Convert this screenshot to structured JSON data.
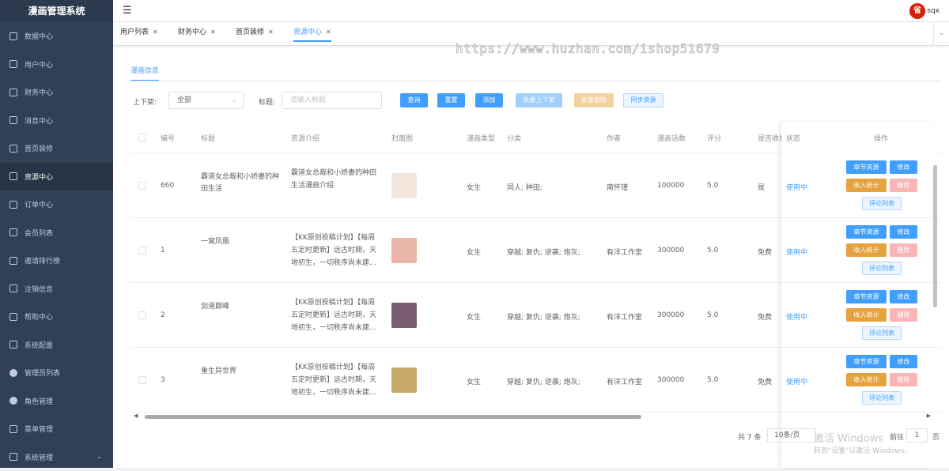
{
  "app": {
    "title": "漫画管理系统",
    "username": "sqx",
    "avatar_text": "省"
  },
  "sidebar": {
    "items": [
      {
        "label": "数据中心",
        "icon": "monitor-icon"
      },
      {
        "label": "用户中心",
        "icon": "user-icon"
      },
      {
        "label": "财务中心",
        "icon": "wallet-icon"
      },
      {
        "label": "消息中心",
        "icon": "message-icon"
      },
      {
        "label": "首页装修",
        "icon": "cube-icon"
      },
      {
        "label": "资源中心",
        "icon": "document-icon"
      },
      {
        "label": "订单中心",
        "icon": "order-icon"
      },
      {
        "label": "会员列表",
        "icon": "grid-icon"
      },
      {
        "label": "邀请排行榜",
        "icon": "bar-chart-icon"
      },
      {
        "label": "注销信息",
        "icon": "inbox-icon"
      },
      {
        "label": "帮助中心",
        "icon": "help-doc-icon"
      },
      {
        "label": "系统配置",
        "icon": "list-icon"
      },
      {
        "label": "管理员列表",
        "icon": "person-icon"
      },
      {
        "label": "角色管理",
        "icon": "role-icon"
      },
      {
        "label": "菜单管理",
        "icon": "menu-list-icon"
      },
      {
        "label": "系统管理",
        "icon": "settings-icon"
      }
    ]
  },
  "tags": [
    {
      "label": "用户列表"
    },
    {
      "label": "财务中心"
    },
    {
      "label": "首页装修"
    },
    {
      "label": "资源中心"
    }
  ],
  "subtab": "漫画信息",
  "filters": {
    "status_label": "上下架:",
    "status_value": "全部",
    "title_label": "标题:",
    "title_placeholder": "请输入标题"
  },
  "buttons": {
    "query": "查询",
    "reset": "重置",
    "add": "添加",
    "batch_shelf": "批量上下架",
    "batch_delete": "批量删除",
    "sync": "同步资源"
  },
  "table": {
    "columns": [
      "编号",
      "标题",
      "资源介绍",
      "封面图",
      "漫画类型",
      "分类",
      "作者",
      "漫画话数",
      "评分",
      "是否收费",
      "状态",
      "操作"
    ],
    "rows": [
      {
        "id": "660",
        "title": "霸道女总裁和小娇妻的种田生活",
        "intro": "霸道女总裁和小娇妻的种田生活漫画介绍",
        "cover_color": "#f2e6dc",
        "type": "女生",
        "category": "同人; 种田;",
        "author": "南怀瑾",
        "episodes": "100000",
        "score": "5.0",
        "paid": "是",
        "status": "使用中"
      },
      {
        "id": "1",
        "title": "一窝凤凰",
        "intro": "【KK原创投稿计划】【每周五定时更新】远古时期，天地初生，一切秩序尚未建…",
        "cover_color": "#e8b5a8",
        "type": "女生",
        "category": "穿越; 复仇; 逆袭; 炮灰;",
        "author": "有洋工作室",
        "episodes": "300000",
        "score": "5.0",
        "paid": "免费",
        "status": "使用中"
      },
      {
        "id": "2",
        "title": "剑道巅峰",
        "intro": "【KK原创投稿计划】【每周五定时更新】远古时期，天地初生，一切秩序尚未建…",
        "cover_color": "#7a5e70",
        "type": "女生",
        "category": "穿越; 复仇; 逆袭; 炮灰;",
        "author": "有洋工作室",
        "episodes": "300000",
        "score": "5.0",
        "paid": "免费",
        "status": "使用中"
      },
      {
        "id": "3",
        "title": "重生异世界",
        "intro": "【KK原创投稿计划】【每周五定时更新】远古时期，天地初生，一切秩序尚未建…",
        "cover_color": "#c9a76a",
        "type": "女生",
        "category": "穿越; 复仇; 逆袭; 炮灰;",
        "author": "有洋工作室",
        "episodes": "300000",
        "score": "5.0",
        "paid": "免费",
        "status": "使用中"
      }
    ],
    "actions": {
      "chapters": "章节资源",
      "edit": "修改",
      "income": "收入统计",
      "delete": "删除",
      "comments": "评论列表"
    }
  },
  "pagination": {
    "total": "共 7 条",
    "page_size": "10条/页",
    "goto_label": "前往",
    "page": "1",
    "page_suffix": "页"
  },
  "overlay": {
    "watermark": "https://www.huzhan.com/ishop51679",
    "activate_title": "激活 Windows",
    "activate_sub": "转到\"设置\"以激活 Windows。"
  }
}
